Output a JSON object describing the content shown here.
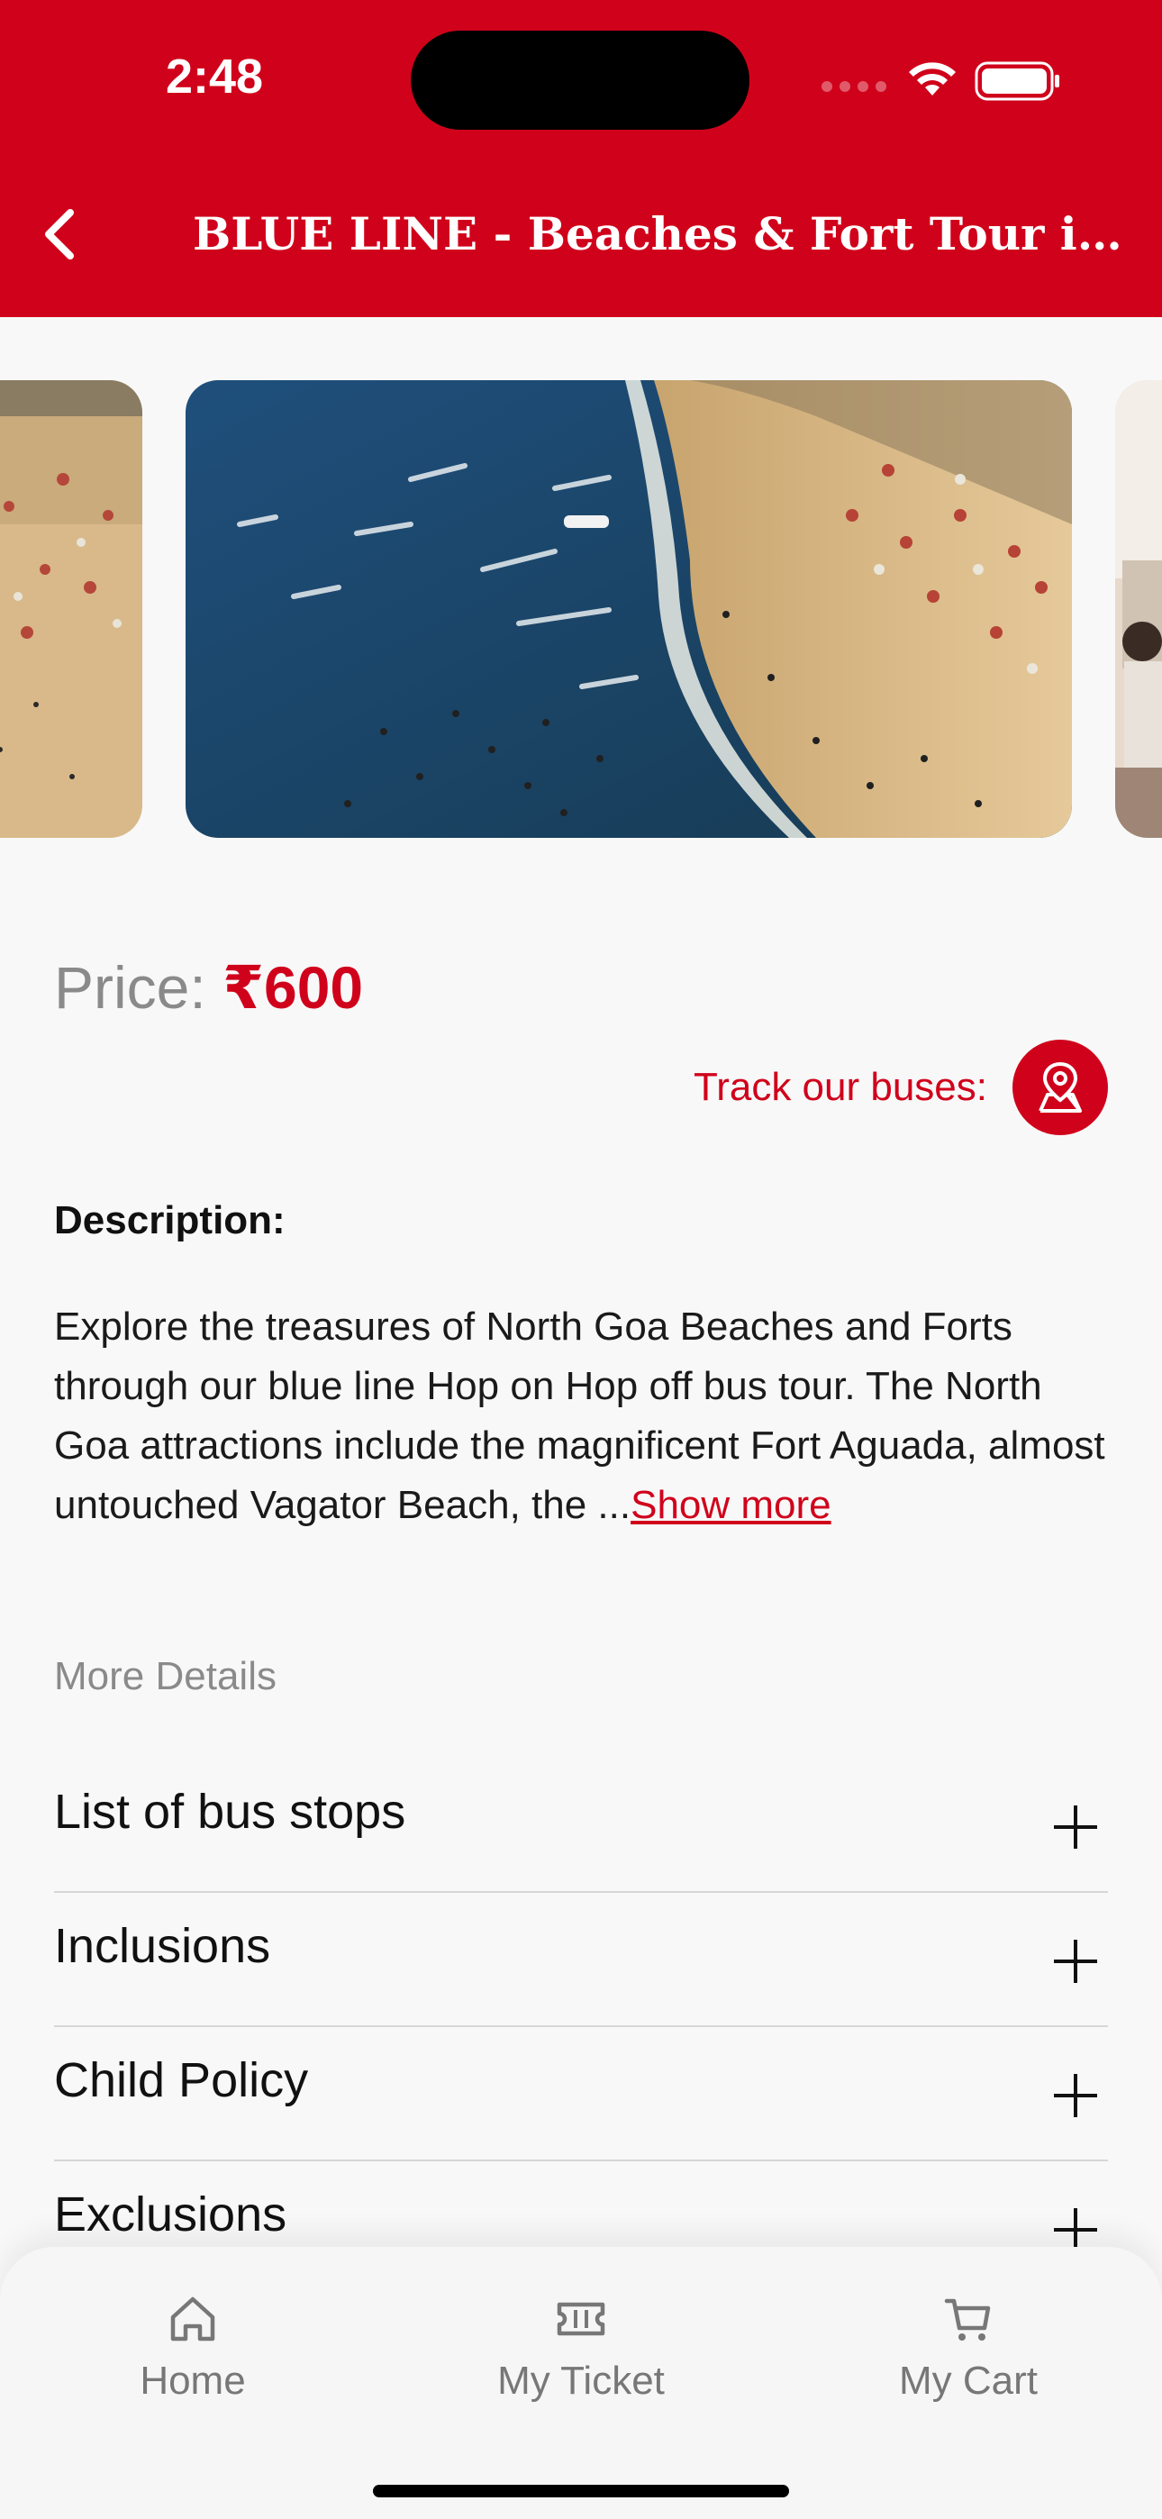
{
  "status_bar": {
    "time": "2:48"
  },
  "header": {
    "title": "BLUE LINE - Beaches & Fort Tour in North Goa",
    "back_label": "Back"
  },
  "gallery": {
    "images": [
      "beach-photo",
      "beach-aerial-photo",
      "bus-interior-photo"
    ]
  },
  "price": {
    "label": "Price:",
    "value": "₹600"
  },
  "track": {
    "label": "Track our buses:",
    "icon": "map-pin-icon"
  },
  "description": {
    "title": "Description:",
    "text": "Explore the treasures of North Goa Beaches and Forts through our blue line  Hop on Hop off bus tour. The North Goa attractions include the magnificent Fort Aguada, almost untouched Vagator Beach, the  ...",
    "show_more": "Show more"
  },
  "more_details": {
    "title": "More Details",
    "items": [
      {
        "label": "List of bus stops"
      },
      {
        "label": "Inclusions"
      },
      {
        "label": "Child Policy"
      },
      {
        "label": "Exclusions"
      }
    ]
  },
  "nav": {
    "items": [
      {
        "label": "Home",
        "icon": "home-icon"
      },
      {
        "label": "My Ticket",
        "icon": "ticket-icon"
      },
      {
        "label": "My Cart",
        "icon": "cart-icon"
      }
    ]
  },
  "colors": {
    "brand": "#d0021b",
    "muted": "#8a8a8a"
  }
}
